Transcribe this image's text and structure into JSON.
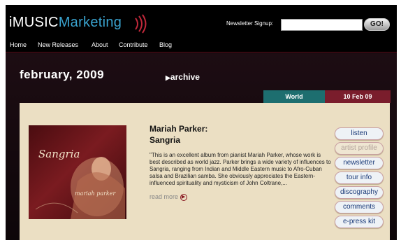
{
  "header": {
    "logo_part1": "iMUSIC",
    "logo_part2": "Marketing",
    "newsletter_label": "Newsletter Signup:",
    "newsletter_value": "",
    "go_label": "GO!"
  },
  "nav": {
    "items": [
      "Home",
      "New Releases",
      "About",
      "Contribute",
      "Blog"
    ]
  },
  "main": {
    "month": "february, 2009",
    "archive_label": "archive",
    "tabs": {
      "genre": "World",
      "date": "10 Feb 09"
    },
    "album": {
      "artist": "Mariah Parker:",
      "title": "Sangria",
      "cover_title": "Sangria",
      "cover_artist": "mariah parker",
      "description": "\"This is an excellent album from pianist Mariah Parker, whose work is best described as world jazz. Parker brings a wide variety of influences to Sangria, ranging from Indian and Middle Eastern music to Afro-Cuban salsa and Brazilian samba. She obviously appreciates the Eastern-influenced spirituality and mysticism of John Coltrane,...",
      "read_more": "read more"
    },
    "side_buttons": [
      "listen",
      "artist profile",
      "newsletter",
      "tour info",
      "discography",
      "comments",
      "e-press kit"
    ]
  },
  "colors": {
    "logo_accent": "#3aa3cf",
    "world_tab": "#1d6e6f",
    "date_tab": "#7a1d2c",
    "panel_bg": "#ebdfc3"
  }
}
